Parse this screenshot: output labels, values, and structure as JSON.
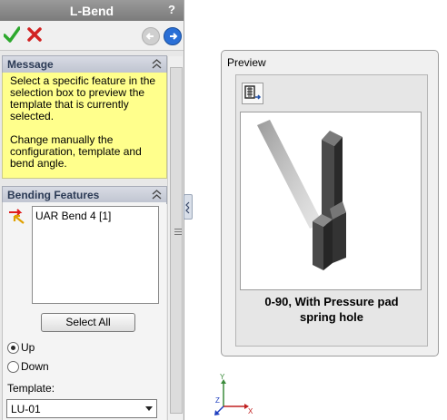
{
  "panel": {
    "title": "L-Bend",
    "help": "?"
  },
  "message": {
    "header": "Message",
    "paragraph1": "Select a specific feature in the selection box to preview the template that is currently selected.",
    "paragraph2": "Change manually the configuration, template and bend angle."
  },
  "bending_features": {
    "header": "Bending Features",
    "list_items": [
      "UAR Bend 4 [1]"
    ],
    "select_all_label": "Select All",
    "radio_up": "Up",
    "radio_down": "Down",
    "selected_direction": "Up",
    "template_label": "Template:",
    "template_value": "LU-01"
  },
  "preview": {
    "title": "Preview",
    "caption_line1": "0-90, With Pressure pad",
    "caption_line2": "spring hole"
  },
  "triad": {
    "x": "X",
    "y": "Y",
    "z": "Z"
  },
  "colors": {
    "message_bg": "#ffff8c",
    "ok": "#2da82d",
    "cancel": "#d22222",
    "forward": "#2a6fd6"
  }
}
